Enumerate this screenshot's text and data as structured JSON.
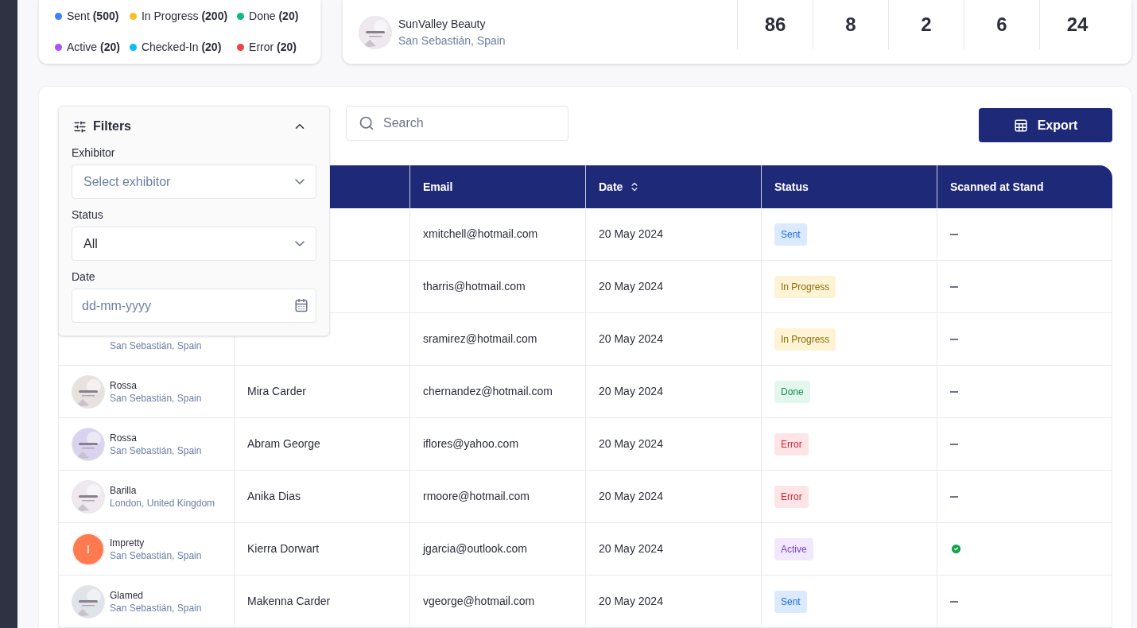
{
  "legend": [
    {
      "label": "Sent **(500)**",
      "color": "#3b82f6"
    },
    {
      "label": "In Progress **(200)**",
      "color": "#fbbf24"
    },
    {
      "label": "Done **(20)**",
      "color": "#10b981"
    },
    {
      "label": "Active **(20)**",
      "color": "#a855f7"
    },
    {
      "label": "Checked-In **(20)**",
      "color": "#0ebcf5"
    },
    {
      "label": "Error **(20)**",
      "color": "#ef4444"
    }
  ],
  "stats_row": {
    "name": "SunValley Beauty",
    "location": "San Sebastián, Spain",
    "values": [
      "86",
      "8",
      "2",
      "6",
      "24"
    ]
  },
  "filters": {
    "title": "Filters",
    "expanded": true,
    "fields": [
      {
        "kind": "select",
        "label": "Exhibitor",
        "placeholder": "Select exhibitor"
      },
      {
        "kind": "select",
        "label": "Status",
        "value": "All"
      },
      {
        "kind": "date",
        "label": "Date",
        "placeholder": "dd-mm-yyyy"
      }
    ]
  },
  "search": {
    "placeholder": "Search"
  },
  "export_button": "Export",
  "table": {
    "columns": [
      "Email",
      "Date",
      "Status",
      "Scanned at Stand"
    ],
    "rows": [
      {
        "email": "xmitchell@hotmail.com",
        "date": "20 May 2024",
        "status": {
          "label": "Sent",
          "kind": "sent"
        },
        "scanned": false
      },
      {
        "email": "tharris@hotmail.com",
        "date": "20 May 2024",
        "status": {
          "label": "In Progress",
          "kind": "progress"
        },
        "scanned": false
      },
      {
        "exhibitor": {
          "location": "San Sebastián, Spain"
        },
        "email": "sramirez@hotmail.com",
        "date": "20 May 2024",
        "status": {
          "label": "In Progress",
          "kind": "progress"
        },
        "scanned": false
      },
      {
        "exhibitor": {
          "name": "Rossa",
          "location": "San Sebastián, Spain",
          "avatar": {
            "kind": "logo"
          }
        },
        "name": "Mira Carder",
        "email": "chernandez@hotmail.com",
        "date": "20 May 2024",
        "status": {
          "label": "Done",
          "kind": "done"
        },
        "scanned": false
      },
      {
        "exhibitor": {
          "name": "Rossa",
          "location": "San Sebastián, Spain",
          "avatar": {
            "kind": "logo"
          }
        },
        "name": "Abram George",
        "email": "iflores@yahoo.com",
        "date": "20 May 2024",
        "status": {
          "label": "Error",
          "kind": "error"
        },
        "scanned": false
      },
      {
        "exhibitor": {
          "name": "Barilla",
          "location": "London, United Kingdom",
          "avatar": {
            "kind": "logo"
          }
        },
        "name": "Anika Dias",
        "email": "rmoore@hotmail.com",
        "date": "20 May 2024",
        "status": {
          "label": "Error",
          "kind": "error"
        },
        "scanned": false
      },
      {
        "exhibitor": {
          "name": "Impretty",
          "location": "San Sebastián, Spain",
          "avatar": {
            "kind": "initial",
            "letter": "I"
          }
        },
        "name": "Kierra Dorwart",
        "email": "jgarcia@outlook.com",
        "date": "20 May 2024",
        "status": {
          "label": "Active",
          "kind": "active"
        },
        "scanned": true
      },
      {
        "exhibitor": {
          "name": "Glamed",
          "location": "San Sebastián, Spain",
          "avatar": {
            "kind": "logo"
          }
        },
        "name": "Makenna Carder",
        "email": "vgeorge@hotmail.com",
        "date": "20 May 2024",
        "status": {
          "label": "Sent",
          "kind": "sent"
        },
        "scanned": false
      }
    ]
  }
}
